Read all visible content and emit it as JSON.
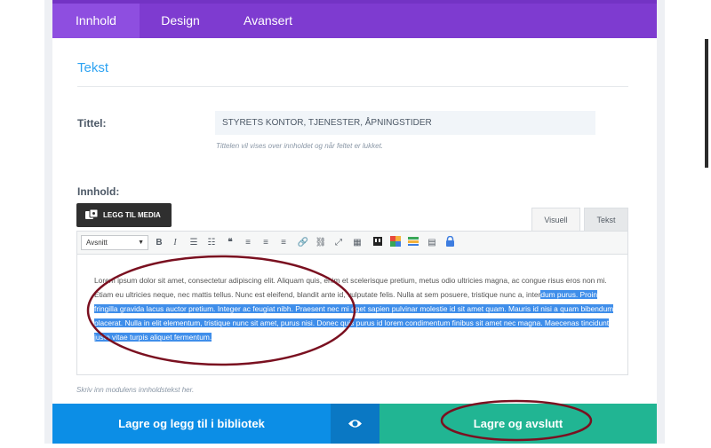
{
  "tabs": [
    {
      "label": "Innhold",
      "active": true
    },
    {
      "label": "Design",
      "active": false
    },
    {
      "label": "Avansert",
      "active": false
    }
  ],
  "section": {
    "title": "Tekst"
  },
  "title_field": {
    "label": "Tittel:",
    "value": "STYRETS KONTOR, TJENESTER, ÅPNINGSTIDER",
    "hint": "Tittelen vil vises over innholdet og når feltet er lukket."
  },
  "content_field": {
    "label": "Innhold:",
    "media_button": "LEGG TIL MEDIA",
    "tab_visual": "Visuell",
    "tab_text": "Tekst",
    "format_select": "Avsnitt",
    "text_plain": "Lorem ipsum dolor sit amet, consectetur adipiscing elit. Aliquam quis, enim et scelerisque pretium, metus odio ultricies magna, ac congue risus eros non mi. Etiam eu ultricies neque, nec mattis tellus. Nunc est eleifend, blandit ante id, vulputate felis. Nulla at sem posuere, tristique nunc a, inter",
    "text_selected": "dum purus. Proin fringilla gravida lacus auctor pretium. Integer ac feugiat nibh. Praesent nec mi eget sapien pulvinar molestie id sit amet quam. Mauris id nisi a quam bibendum placerat. Nulla in elit elementum, tristique nunc sit amet, purus nisi. Donec quis purus id lorem condimentum finibus sit amet nec magna. Maecenas tincidunt justo vitae turpis aliquet fermentum.",
    "hint": "Skriv inn modulens innholdstekst her."
  },
  "footer": {
    "save_library": "Lagre og legg til i bibliotek",
    "save_exit": "Lagre og avslutt"
  },
  "toolbar_icons": [
    "bold-icon",
    "italic-icon",
    "bullet-list-icon",
    "numbered-list-icon",
    "blockquote-icon",
    "align-left-icon",
    "align-center-icon",
    "align-right-icon",
    "link-icon",
    "unlink-icon",
    "fullscreen-icon",
    "toolbar-toggle-icon",
    "shortcode-icon",
    "color-icon",
    "layout-icon",
    "table-icon",
    "lock-icon"
  ],
  "colors": {
    "tab_bar": "#7e3bd0",
    "accent": "#2ea3f2",
    "save_library": "#0c8ee6",
    "save_exit": "#21b593",
    "annotation": "#7a1020"
  }
}
